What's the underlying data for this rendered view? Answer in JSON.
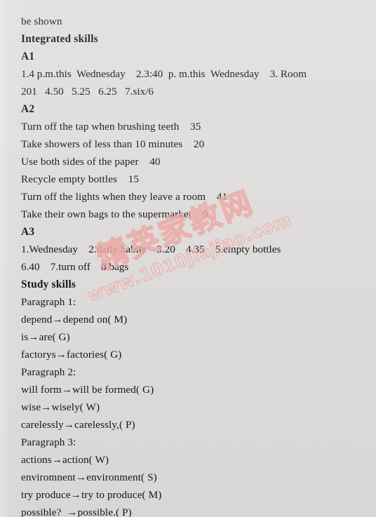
{
  "page": {
    "background_color": "#e0dedd",
    "text_color": "#171615"
  },
  "watermark": {
    "chinese_text": "精英家教网",
    "url_text": "www.1010jiajiao.com",
    "color": "#efa9a4"
  },
  "content": {
    "continuation_line": "be shown",
    "sections": [
      {
        "heading": "Integrated skills",
        "lines": []
      },
      {
        "heading": "A1",
        "lines": [
          "1.4 p.m.this  Wednesday    2.3:40  p. m.this  Wednesday    3. Room",
          "201   4.50   5.25   6.25   7.six/6"
        ]
      },
      {
        "heading": "A2",
        "lines": [
          "Turn off the tap when brushing teeth    35",
          "Take showers of less than 10 minutes    20",
          "Use both sides of the paper    40",
          "Recycle empty bottles    15",
          "Turn off the lights when they leave a room    41",
          "Take their own bags to the supermarket    9"
        ]
      },
      {
        "heading": "A3",
        "lines": [
          "1.Wednesday    2.daily habits    3.20    4.35    5.empty bottles",
          "6.40    7.turn off    8.bags"
        ]
      },
      {
        "heading": "Study skills",
        "lines": [
          "Paragraph 1:",
          "depend→depend on( M)",
          "is→are( G)",
          "factorys→factories( G)",
          "Paragraph 2:",
          "will form→will be formed( G)",
          "wise→wisely( W)",
          "carelessly→carelessly,( P)",
          "Paragraph 3:",
          "actions→action( W)",
          "enviromnent→environment( S)",
          "try produce→try to produce( M)",
          "possible?  →possible.( P)"
        ]
      }
    ]
  }
}
